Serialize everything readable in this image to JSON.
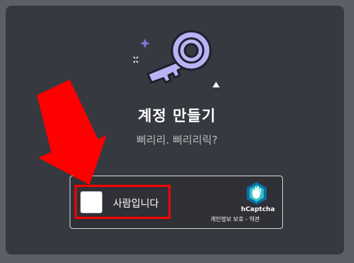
{
  "modal": {
    "title": "계정 만들기",
    "subtitle": "삐리리. 삐리리릭?"
  },
  "captcha": {
    "checkbox_label": "사람입니다",
    "brand": "hCaptcha",
    "privacy_link": "개인정보 보호",
    "separator": "-",
    "terms_link": "약관"
  },
  "icons": {
    "key": "key-icon",
    "sparkle": "sparkle-icon",
    "arrow": "red-arrow-annotation"
  },
  "colors": {
    "page_background": "#5b5f67",
    "modal_background": "#36393f",
    "captcha_background": "#2f3136",
    "key_fill": "#b9b3f6",
    "key_outline": "#1f1f2e",
    "annotation": "#ff0000",
    "hcaptcha_brand": "#0074bf"
  }
}
